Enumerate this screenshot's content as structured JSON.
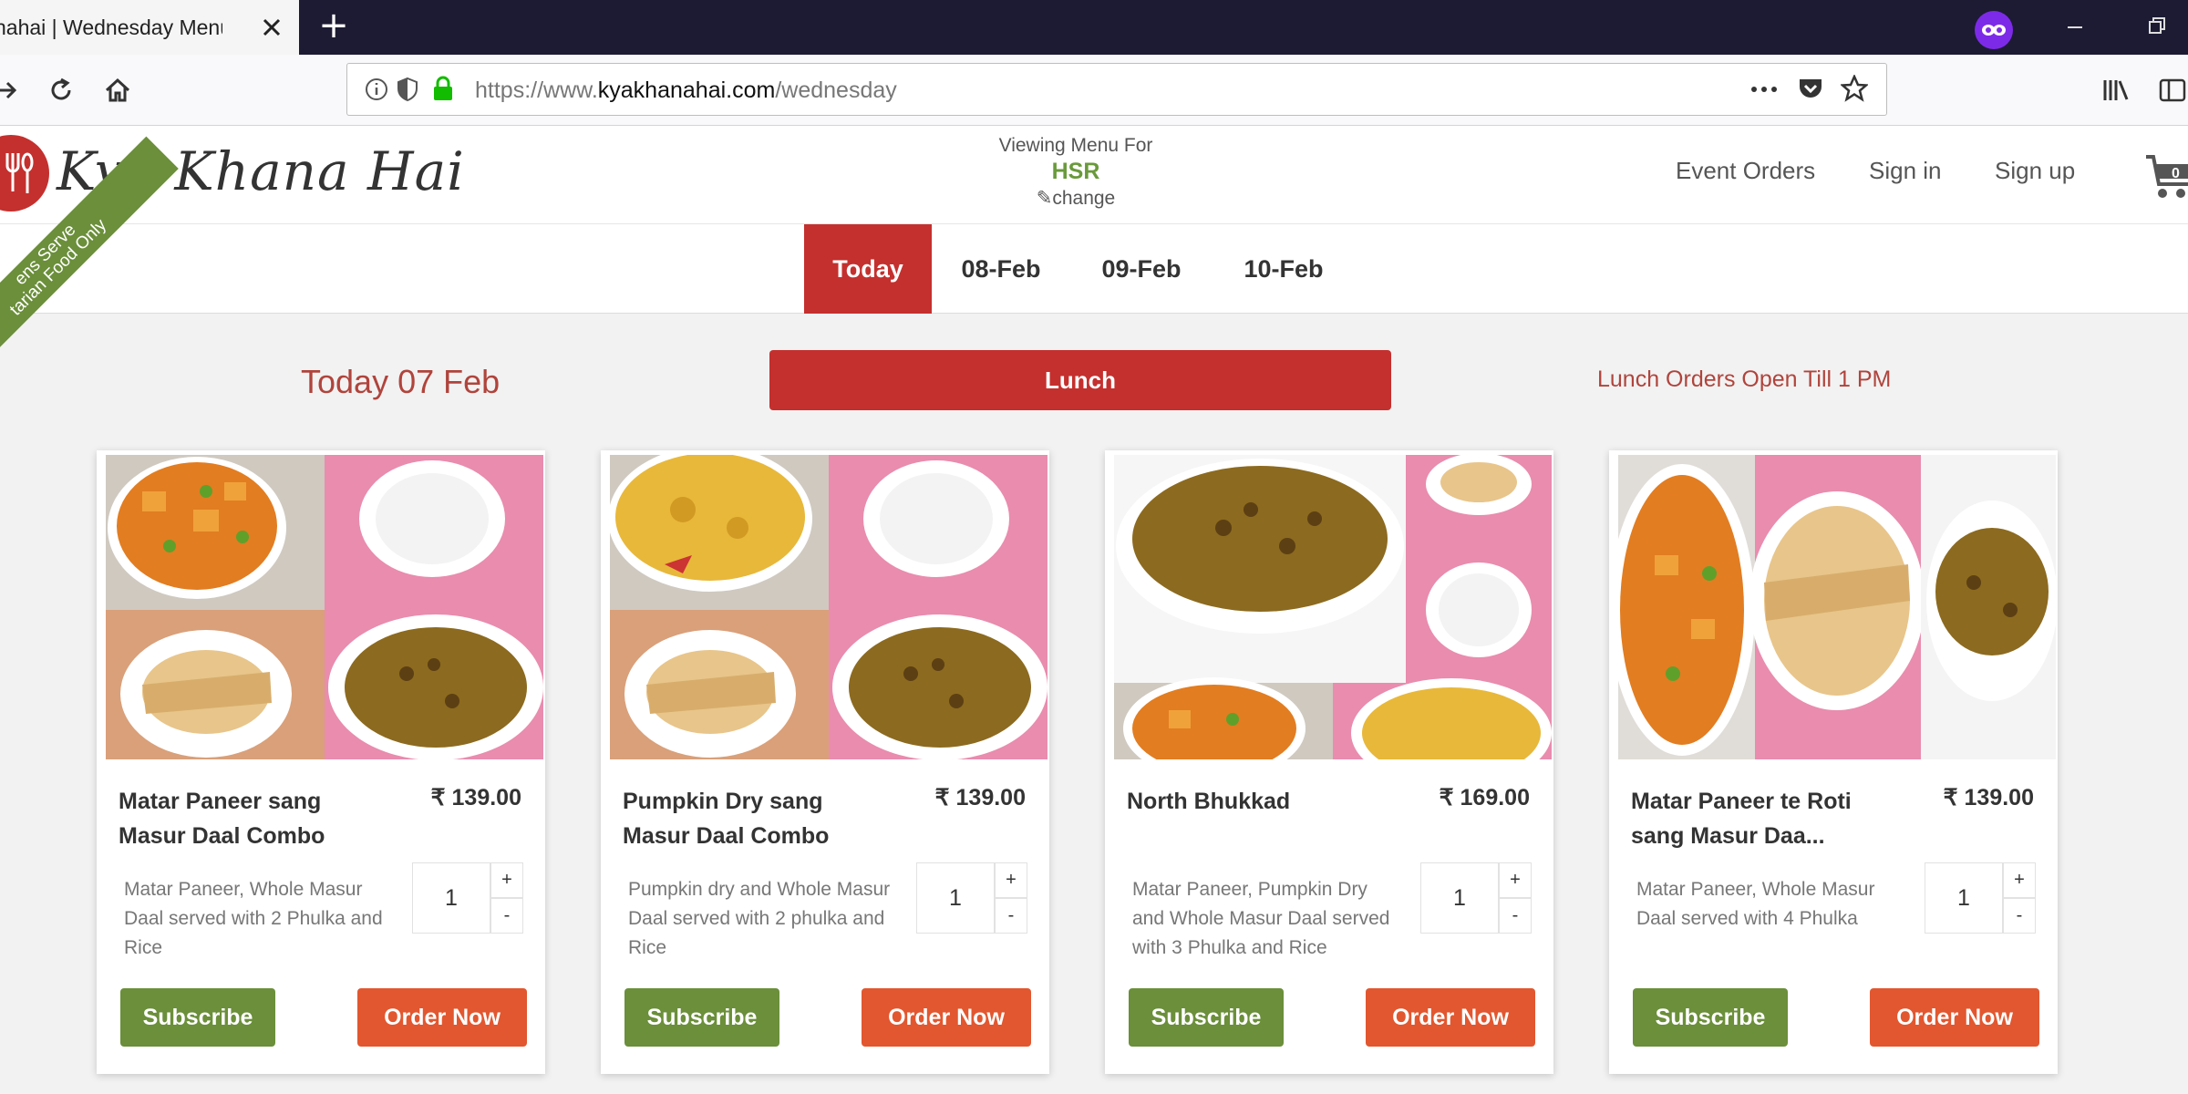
{
  "browser": {
    "tab_title": "nahai | Wednesday Menu - (",
    "url_scheme": "https://www.",
    "url_host": "kyakhanahai.com",
    "url_path": "/wednesday"
  },
  "header": {
    "logo_text": "Kya Khana Hai",
    "viewing_label": "Viewing Menu For",
    "city": "HSR",
    "change_label": "change",
    "links": [
      "Event Orders",
      "Sign in",
      "Sign up"
    ],
    "cart_count": "0"
  },
  "dates": {
    "tabs": [
      "Today",
      "08-Feb",
      "09-Feb",
      "10-Feb"
    ],
    "active": "Today"
  },
  "ribbon": {
    "line1": "ens Serve",
    "line2": "tarian Food Only"
  },
  "menu": {
    "today_title": "Today 07 Feb",
    "meal_button": "Lunch",
    "orders_open": "Lunch Orders Open Till 1 PM"
  },
  "cards": [
    {
      "name": "Matar Paneer sang Masur Daal Combo",
      "price": "₹ 139.00",
      "description": "Matar Paneer, Whole Masur Daal served with 2 Phulka and Rice",
      "qty": "1",
      "subscribe": "Subscribe",
      "order": "Order Now"
    },
    {
      "name": "Pumpkin Dry sang Masur Daal Combo",
      "price": "₹ 139.00",
      "description": "Pumpkin dry and Whole Masur Daal served with 2 phulka and Rice",
      "qty": "1",
      "subscribe": "Subscribe",
      "order": "Order Now"
    },
    {
      "name": "North Bhukkad",
      "price": "₹ 169.00",
      "description": "Matar Paneer, Pumpkin Dry and Whole Masur Daal served with 3 Phulka and Rice",
      "qty": "1",
      "subscribe": "Subscribe",
      "order": "Order Now"
    },
    {
      "name": "Matar Paneer te Roti sang Masur Daa...",
      "price": "₹ 139.00",
      "description": "Matar Paneer, Whole Masur Daal served with 4 Phulka",
      "qty": "1",
      "subscribe": "Subscribe",
      "order": "Order Now"
    }
  ],
  "colors": {
    "brand_red": "#c4302e",
    "subscribe_green": "#6b8f3a",
    "order_orange": "#e2572f"
  }
}
